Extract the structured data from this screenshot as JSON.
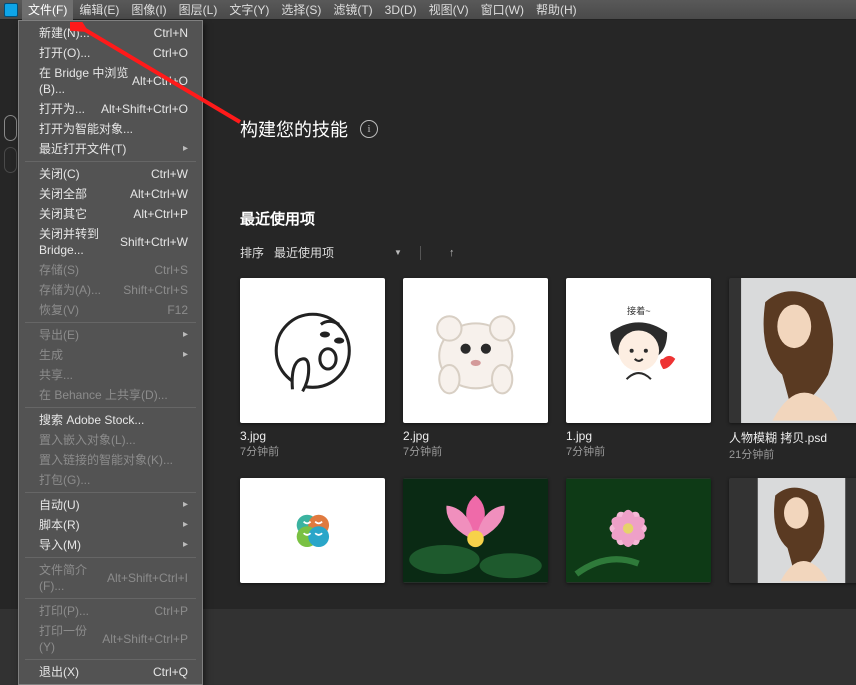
{
  "menubar": {
    "items": [
      "文件(F)",
      "编辑(E)",
      "图像(I)",
      "图层(L)",
      "文字(Y)",
      "选择(S)",
      "滤镜(T)",
      "3D(D)",
      "视图(V)",
      "窗口(W)",
      "帮助(H)"
    ]
  },
  "dropdown": {
    "groups": [
      [
        {
          "label": "新建(N)...",
          "shortcut": "Ctrl+N"
        },
        {
          "label": "打开(O)...",
          "shortcut": "Ctrl+O"
        },
        {
          "label": "在 Bridge 中浏览(B)...",
          "shortcut": "Alt+Ctrl+O"
        },
        {
          "label": "打开为...",
          "shortcut": "Alt+Shift+Ctrl+O"
        },
        {
          "label": "打开为智能对象..."
        },
        {
          "label": "最近打开文件(T)",
          "sub": true
        }
      ],
      [
        {
          "label": "关闭(C)",
          "shortcut": "Ctrl+W"
        },
        {
          "label": "关闭全部",
          "shortcut": "Alt+Ctrl+W"
        },
        {
          "label": "关闭其它",
          "shortcut": "Alt+Ctrl+P"
        },
        {
          "label": "关闭并转到 Bridge...",
          "shortcut": "Shift+Ctrl+W"
        },
        {
          "label": "存储(S)",
          "shortcut": "Ctrl+S",
          "disabled": true
        },
        {
          "label": "存储为(A)...",
          "shortcut": "Shift+Ctrl+S",
          "disabled": true
        },
        {
          "label": "恢复(V)",
          "shortcut": "F12",
          "disabled": true
        }
      ],
      [
        {
          "label": "导出(E)",
          "sub": true,
          "disabled": true
        },
        {
          "label": "生成",
          "sub": true,
          "disabled": true
        },
        {
          "label": "共享...",
          "disabled": true
        },
        {
          "label": "在 Behance 上共享(D)...",
          "disabled": true
        }
      ],
      [
        {
          "label": "搜索 Adobe Stock..."
        },
        {
          "label": "置入嵌入对象(L)...",
          "disabled": true
        },
        {
          "label": "置入链接的智能对象(K)...",
          "disabled": true
        },
        {
          "label": "打包(G)...",
          "disabled": true
        }
      ],
      [
        {
          "label": "自动(U)",
          "sub": true
        },
        {
          "label": "脚本(R)",
          "sub": true
        },
        {
          "label": "导入(M)",
          "sub": true
        }
      ],
      [
        {
          "label": "文件简介(F)...",
          "shortcut": "Alt+Shift+Ctrl+I",
          "disabled": true
        }
      ],
      [
        {
          "label": "打印(P)...",
          "shortcut": "Ctrl+P",
          "disabled": true
        },
        {
          "label": "打印一份(Y)",
          "shortcut": "Alt+Shift+Ctrl+P",
          "disabled": true
        }
      ],
      [
        {
          "label": "退出(X)",
          "shortcut": "Ctrl+Q"
        }
      ]
    ]
  },
  "hero": {
    "title": "构建您的技能",
    "info": "i"
  },
  "section": {
    "title": "最近使用项"
  },
  "sort": {
    "label": "排序",
    "value": "最近使用项",
    "arrow": "↑"
  },
  "files": [
    {
      "name": "3.jpg",
      "time": "7分钟前",
      "kind": "meme-face"
    },
    {
      "name": "2.jpg",
      "time": "7分钟前",
      "kind": "hamster"
    },
    {
      "name": "1.jpg",
      "time": "7分钟前",
      "kind": "girl-heart"
    },
    {
      "name": "人物模糊 拷贝.psd",
      "time": "21分钟前",
      "kind": "model"
    },
    {
      "name": "",
      "time": "",
      "kind": "logo"
    },
    {
      "name": "",
      "time": "",
      "kind": "lotus"
    },
    {
      "name": "",
      "time": "",
      "kind": "pink-flower"
    },
    {
      "name": "",
      "time": "",
      "kind": "model"
    }
  ]
}
